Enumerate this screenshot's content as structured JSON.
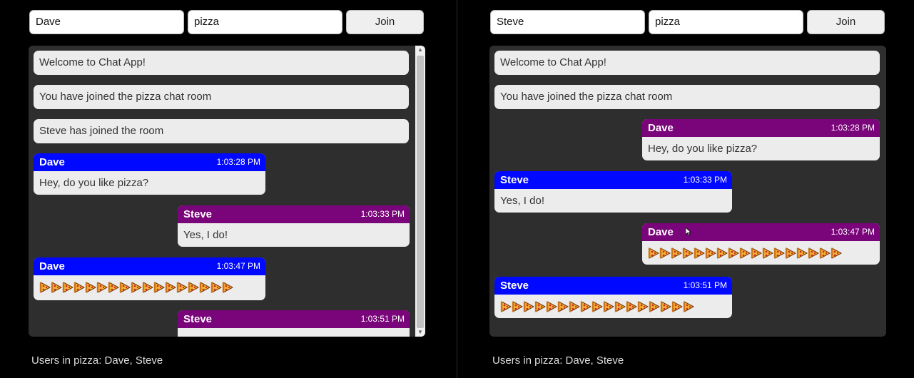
{
  "left": {
    "name_value": "Dave",
    "room_value": "pizza",
    "join_label": "Join",
    "system_messages": [
      "Welcome to Chat App!",
      "You have joined the pizza chat room",
      "Steve has joined the room"
    ],
    "messages": [
      {
        "user": "Dave",
        "time": "1:03:28 PM",
        "text": "Hey, do you like pizza?"
      },
      {
        "user": "Steve",
        "time": "1:03:33 PM",
        "text": "Yes, I do!"
      },
      {
        "user": "Dave",
        "time": "1:03:47 PM",
        "pizza_count": 17
      },
      {
        "user": "Steve",
        "time": "1:03:51 PM"
      }
    ],
    "users_text": "Users in pizza: Dave, Steve"
  },
  "right": {
    "name_value": "Steve",
    "room_value": "pizza",
    "join_label": "Join",
    "system_messages": [
      "Welcome to Chat App!",
      "You have joined the pizza chat room"
    ],
    "messages": [
      {
        "user": "Dave",
        "time": "1:03:28 PM",
        "text": "Hey, do you like pizza?"
      },
      {
        "user": "Steve",
        "time": "1:03:33 PM",
        "text": "Yes, I do!"
      },
      {
        "user": "Dave",
        "time": "1:03:47 PM",
        "pizza_count": 17
      },
      {
        "user": "Steve",
        "time": "1:03:51 PM",
        "pizza_count": 17
      }
    ],
    "users_text": "Users in pizza: Dave, Steve"
  },
  "icons": {
    "message_icon": "pizza-slice-icon",
    "scroll_up": "scroll-up-arrow-icon",
    "scroll_down": "scroll-down-arrow-icon"
  },
  "colors": {
    "self_header": "#0008ff",
    "other_header": "#7a047a",
    "chat_bg": "#2e2e2e",
    "page_bg": "#000000"
  }
}
